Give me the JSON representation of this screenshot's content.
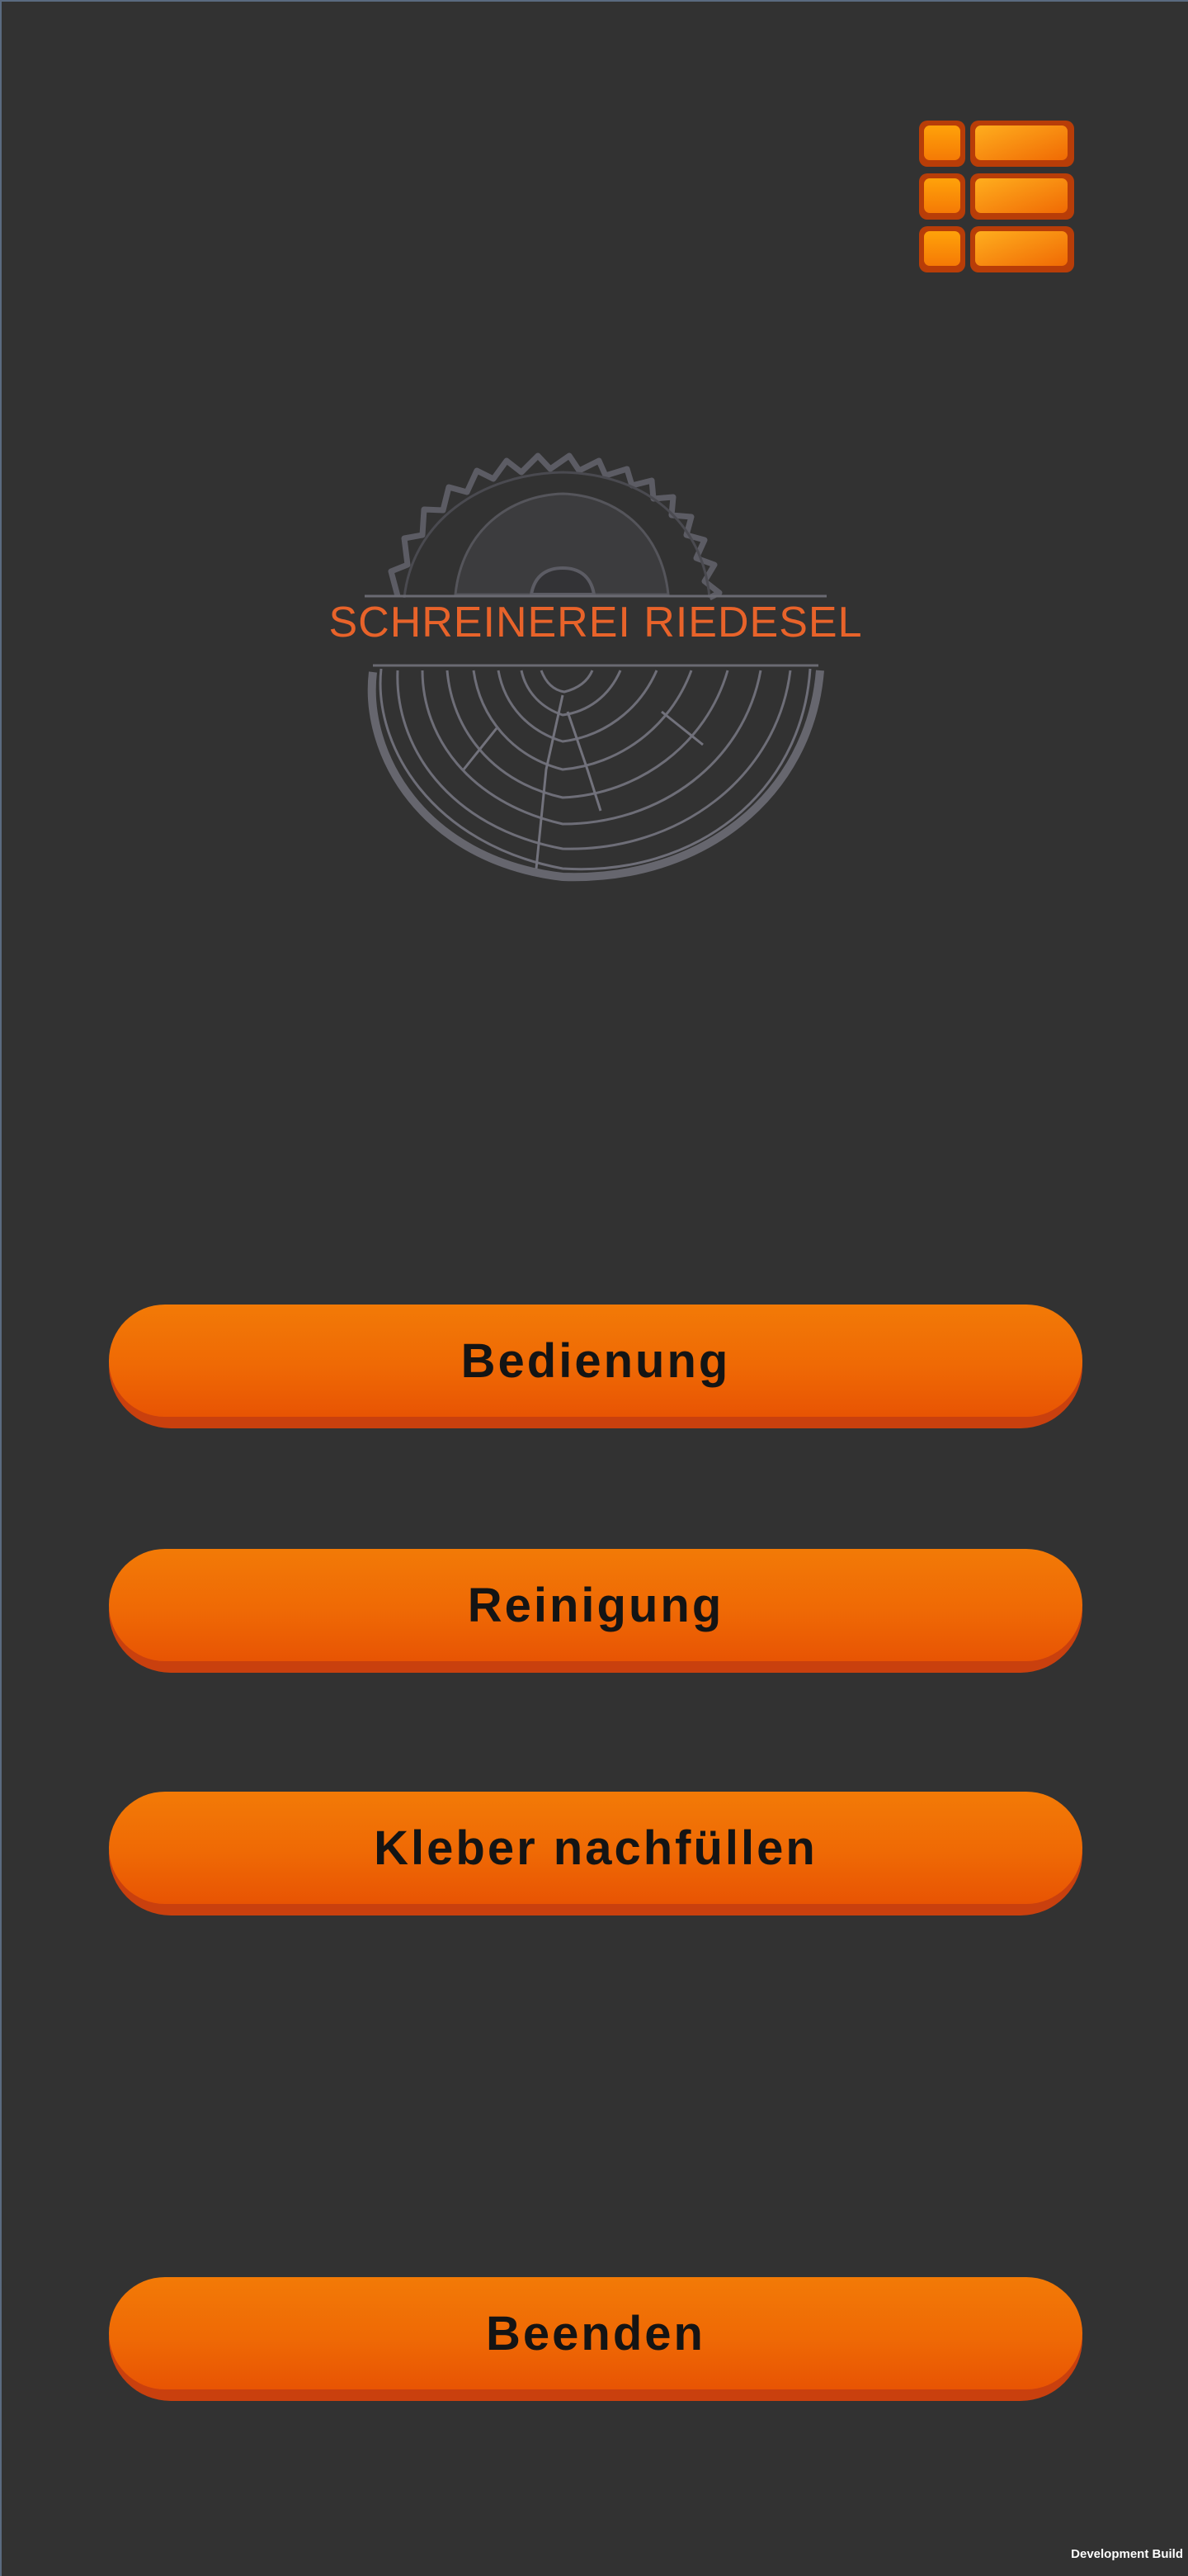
{
  "logo": {
    "title": "SCHREINEREI RIEDESEL"
  },
  "menu": {
    "icon": "list-menu-icon"
  },
  "buttons": {
    "operation": "Bedienung",
    "cleaning": "Reinigung",
    "refill_glue": "Kleber nachfüllen",
    "quit": "Beenden"
  },
  "footer": {
    "build_label": "Development Build"
  },
  "colors": {
    "background": "#323232",
    "accent": "#ef6905",
    "logo_text": "#e8632a",
    "logo_lines": "#6e6e78"
  }
}
